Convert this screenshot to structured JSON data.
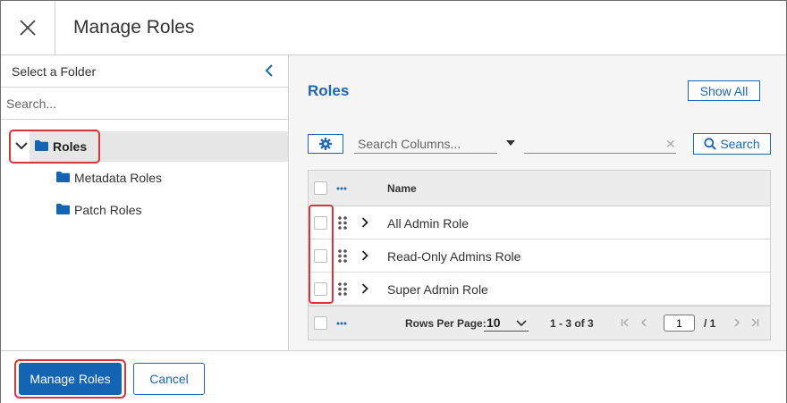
{
  "header": {
    "title": "Manage Roles",
    "close_icon": "close-icon"
  },
  "left_panel": {
    "heading": "Select a Folder",
    "search_placeholder": "Search...",
    "tree": {
      "root": {
        "label": "Roles",
        "expanded": true,
        "selected": true
      },
      "children": [
        {
          "label": "Metadata Roles"
        },
        {
          "label": "Patch Roles"
        }
      ]
    }
  },
  "right_panel": {
    "title": "Roles",
    "show_all_label": "Show All",
    "filter": {
      "column_placeholder": "Search Columns...",
      "value": "",
      "clear": "✕",
      "search_label": "Search"
    },
    "grid": {
      "column_name": "Name",
      "rows": [
        {
          "name": "All Admin Role"
        },
        {
          "name": "Read-Only Admins Role"
        },
        {
          "name": "Super Admin Role"
        }
      ],
      "pagination": {
        "rows_per_page_label": "Rows Per Page:",
        "rows_per_page": "10",
        "range": "1 - 3 of 3",
        "page": "1",
        "total_pages": "/ 1"
      }
    }
  },
  "footer": {
    "primary_label": "Manage Roles",
    "cancel_label": "Cancel"
  },
  "colors": {
    "accent": "#1f67b1",
    "primary_button": "#1464b4",
    "highlight": "#d8343b",
    "folder": "#1464b4"
  }
}
